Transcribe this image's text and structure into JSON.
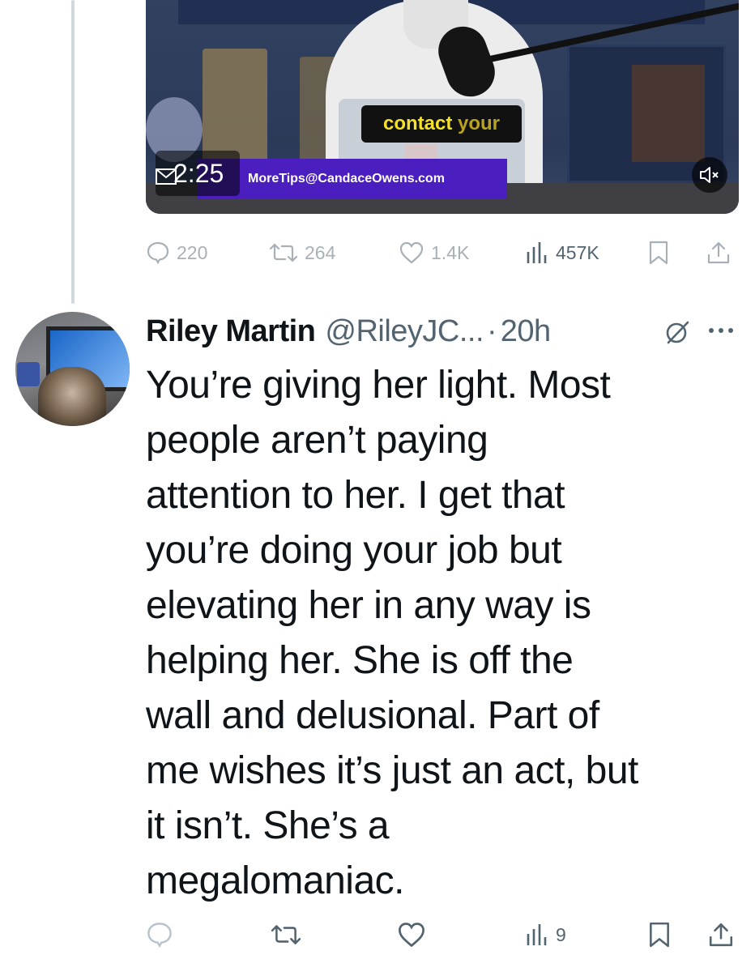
{
  "video": {
    "duration": "2:25",
    "caption_word1": "contact",
    "caption_word2": "your",
    "banner_text": "MoreTips@CandaceOwens.com",
    "mute_icon": "speaker-muted-icon"
  },
  "original_tweet": {
    "replies": "220",
    "reposts": "264",
    "likes": "1.4K",
    "views": "457K"
  },
  "reply": {
    "display_name": "Riley Martin",
    "handle": "@RileyJC...",
    "separator": "·",
    "time": "20h",
    "body_lines": [
      "You’re giving her light. Most",
      "people aren’t paying",
      "attention to her. I get that",
      "you’re doing your job but",
      "elevating her in any way is",
      "helping her. She is off the",
      "wall and delusional. Part of",
      "me wishes it’s just an act, but",
      "it isn’t. She’s a",
      "megalomaniac."
    ],
    "views": "9"
  },
  "colors": {
    "text_primary": "#0f1419",
    "text_secondary": "#536471",
    "thread_line": "#cfd9de",
    "banner": "#4b1fbf",
    "caption_highlight": "#f5e02b"
  }
}
